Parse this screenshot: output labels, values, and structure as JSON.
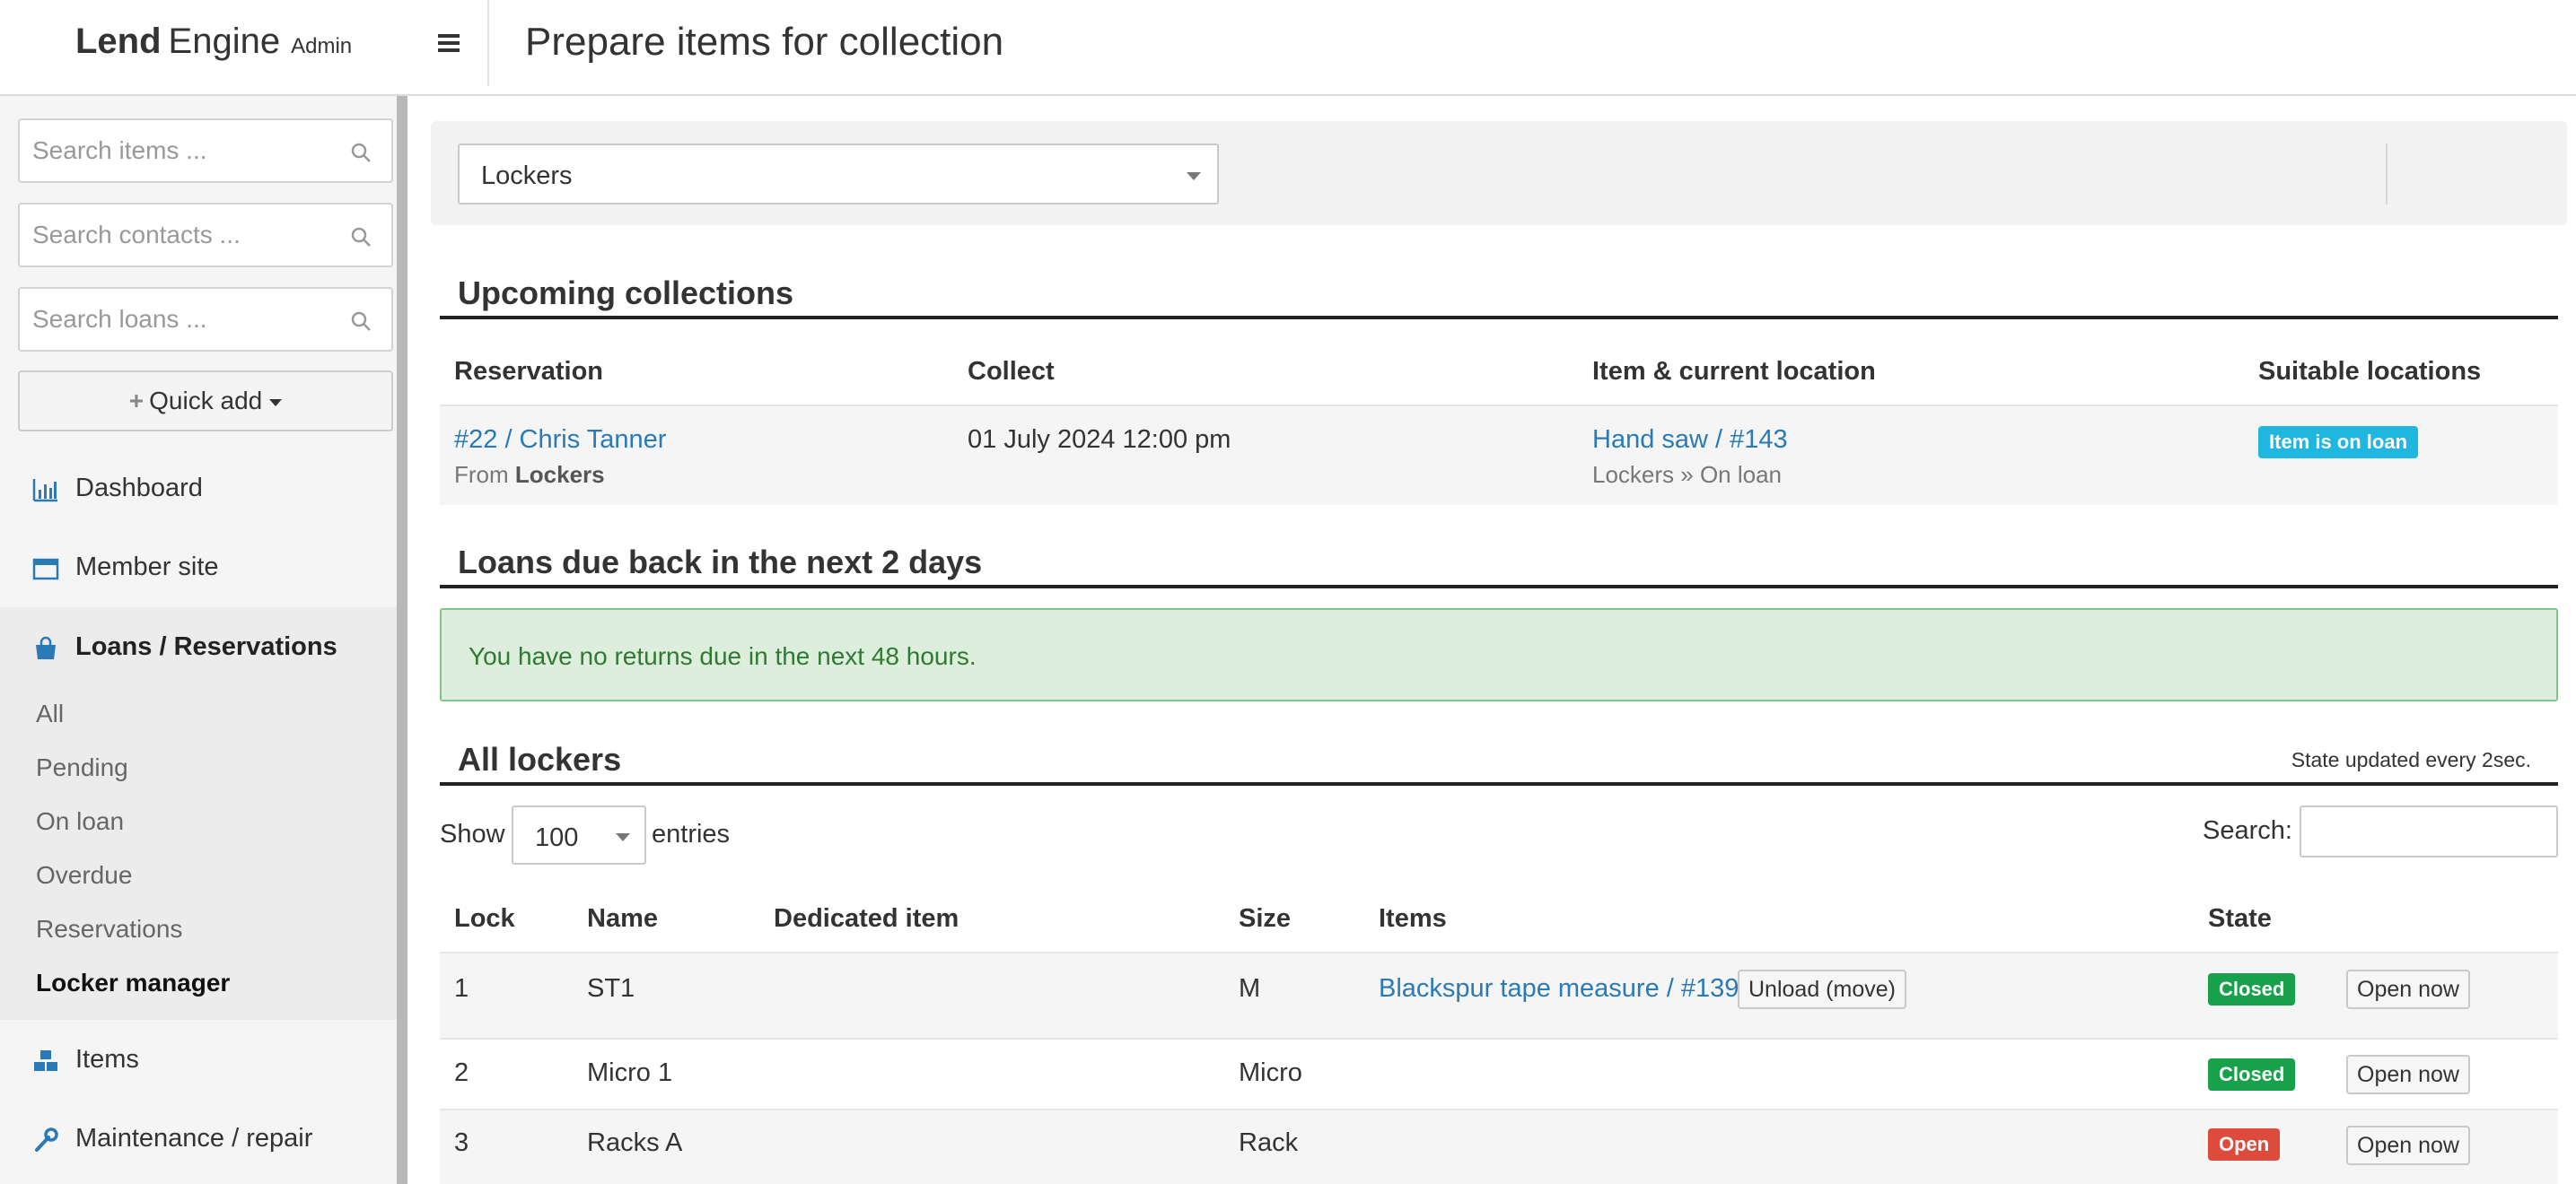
{
  "header": {
    "brand_bold": "Lend",
    "brand_regular": "Engine",
    "brand_small": "Admin",
    "page_title": "Prepare items for collection"
  },
  "sidebar": {
    "search_items_placeholder": "Search items ...",
    "search_contacts_placeholder": "Search contacts ...",
    "search_loans_placeholder": "Search loans ...",
    "quick_add_label": "Quick add",
    "nav": {
      "dashboard": "Dashboard",
      "member_site": "Member site",
      "loans": "Loans / Reservations",
      "items": "Items",
      "maintenance": "Maintenance / repair"
    },
    "loans_sub": [
      "All",
      "Pending",
      "On loan",
      "Overdue",
      "Reservations",
      "Locker manager"
    ]
  },
  "filter": {
    "location_selected": "Lockers"
  },
  "upcoming": {
    "title": "Upcoming collections",
    "columns": [
      "Reservation",
      "Collect",
      "Item & current location",
      "Suitable locations"
    ],
    "rows": [
      {
        "reservation": "#22 / Chris Tanner",
        "from_prefix": "From",
        "from_location": "Lockers",
        "collect": "01 July 2024 12:00 pm",
        "item": "Hand saw / #143",
        "item_location": "Lockers » On loan",
        "suitable": "Item is on loan"
      }
    ]
  },
  "loans_due": {
    "title": "Loans due back in the next 2 days",
    "message": "You have no returns due in the next 48 hours."
  },
  "lockers": {
    "title": "All lockers",
    "state_note": "State updated every 2sec.",
    "show_label": "Show",
    "entries_value": "100",
    "entries_label": "entries",
    "search_label": "Search:",
    "search_value": "",
    "columns": [
      "Lock",
      "Name",
      "Dedicated item",
      "Size",
      "Items",
      "State"
    ],
    "rows": [
      {
        "lock": "1",
        "name": "ST1",
        "dedicated": "",
        "size": "M",
        "item": "Blackspur tape measure / #139",
        "unload_label": "Unload (move)",
        "state": "Closed",
        "open_label": "Open now"
      },
      {
        "lock": "2",
        "name": "Micro 1",
        "dedicated": "",
        "size": "Micro",
        "item": "",
        "state": "Closed",
        "open_label": "Open now"
      },
      {
        "lock": "3",
        "name": "Racks A",
        "dedicated": "",
        "size": "Rack",
        "item": "",
        "state": "Open",
        "open_label": "Open now"
      }
    ]
  },
  "colors": {
    "link": "#2a7ab8",
    "nav_icon": "#2a7ab8",
    "badge_info": "#1fb6e0",
    "badge_closed": "#18a14a",
    "badge_open": "#de4a3c",
    "alert_bg": "#ddefdc",
    "alert_text": "#2f7a33"
  }
}
